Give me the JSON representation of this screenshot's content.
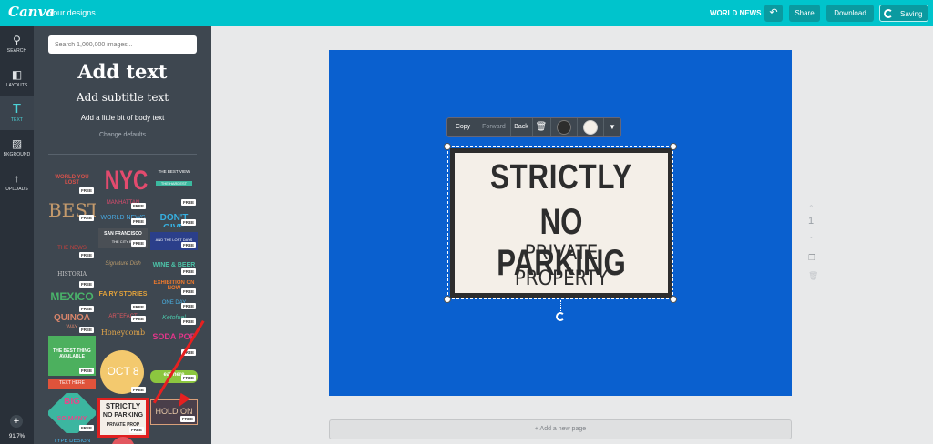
{
  "topbar": {
    "logo": "Canva",
    "your_designs": "Your designs",
    "doc_title": "WORLD NEWS",
    "undo_icon": "undo-icon",
    "share": "Share",
    "download": "Download",
    "saving": "Saving"
  },
  "rail": {
    "items": [
      {
        "icon": "search-icon",
        "glyph": "⚲",
        "label": "SEARCH"
      },
      {
        "icon": "layouts-icon",
        "glyph": "◧",
        "label": "LAYOUTS"
      },
      {
        "icon": "text-icon",
        "glyph": "T",
        "label": "TEXT"
      },
      {
        "icon": "background-icon",
        "glyph": "▨",
        "label": "BKGROUND"
      },
      {
        "icon": "upload-icon",
        "glyph": "↑",
        "label": "UPLOADS"
      }
    ],
    "add": "+",
    "zoom": "91.7%"
  },
  "panel": {
    "search_placeholder": "Search 1,000,000 images...",
    "add_text": "Add text",
    "add_subtitle": "Add subtitle text",
    "add_body": "Add a little bit of body text",
    "change_defaults": "Change defaults",
    "free_badge": "FREE",
    "tiles": {
      "t1": "WORLD YOU LOST",
      "t2": "NYC",
      "t2b": "MANHATTAN",
      "t3": "THE BEST VIEW",
      "t3b": "THE HARDEST",
      "t4": "BEST",
      "t5": "WORLD NEWS",
      "t6": "DON'T GIVE",
      "t7": "SAN FRANCISCO",
      "t7b": "THE CITY BY",
      "t8": "AND THE LOST DAYS",
      "t9": "THE NEWS",
      "t10": "WINE & BEER",
      "t11": "HISTORIA",
      "t12": "Signature Dish",
      "t13": "EXHIBITION ON NOW",
      "t14": "MEXICO",
      "t15": "FAIRY STORIES",
      "t16": "ONE DAY",
      "t17": "QUINOA",
      "t17b": "WAY",
      "t18": "ARTEFACT",
      "t19": "Ketofuel",
      "t20": "THE BEST THING AVAILABLE",
      "t21": "Honeycomb",
      "t22": "SODA POP",
      "t23": "OCT 8",
      "t24": "eat here",
      "t25": "TEXT HERE",
      "t26": "BIG",
      "t26b": "SO MANY",
      "t27": "STRICTLY",
      "t27b": "NO PARKING",
      "t27c": "PRIVATE PROP",
      "t28": "HOLD ON",
      "t29": "TYPE DESIGN"
    }
  },
  "canvas": {
    "background": "#0a60cf",
    "sign": {
      "line1": "STRICTLY",
      "line2": "NO PARKING",
      "line3": "PRIVATE",
      "line4": "PROPERTY"
    },
    "toolbar": {
      "copy": "Copy",
      "forward": "Forward",
      "back": "Back",
      "trash_icon": "trash-icon",
      "color1": "#2d2d2d",
      "color2": "#f4efe8",
      "more_icon": "chevron-down-icon"
    }
  },
  "pages": {
    "current": "1",
    "add_page": "+ Add a new page"
  }
}
